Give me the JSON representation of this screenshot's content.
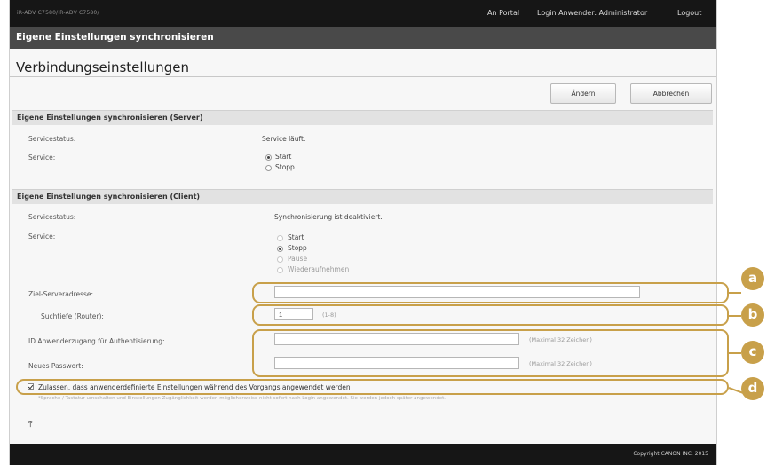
{
  "header": {
    "device_name": "iR-ADV C7580/iR-ADV C7580/",
    "links": [
      "An Portal",
      "Login Anwender: Administrator",
      "Logout"
    ]
  },
  "window_title": "Eigene Einstellungen synchronisieren",
  "page_title": "Verbindungseinstellungen",
  "buttons": {
    "apply": "Ändern",
    "cancel": "Abbrechen"
  },
  "server_section": {
    "title": "Eigene Einstellungen synchronisieren (Server)",
    "status_label": "Servicestatus:",
    "status_value": "Service läuft.",
    "service_label": "Service:",
    "options": [
      "Start",
      "Stopp"
    ],
    "selected": "Start"
  },
  "client_section": {
    "title": "Eigene Einstellungen synchronisieren (Client)",
    "status_label": "Servicestatus:",
    "status_value": "Synchronisierung ist deaktiviert.",
    "service_label": "Service:",
    "options": [
      "Start",
      "Stopp",
      "Pause",
      "Wiederaufnehmen"
    ],
    "selected": "Stopp",
    "server_address_label": "Ziel-Serveradresse:",
    "server_address_value": "",
    "search_depth_label": "Suchtiefe (Router):",
    "search_depth_value": "1",
    "search_depth_hint": "(1-8)",
    "user_id_label": "ID Anwenderzugang für Authentisierung:",
    "user_id_hint": "(Maximal 32 Zeichen)",
    "password_label": "Neues Passwort:",
    "password_hint": "(Maximal 32 Zeichen)",
    "allow_checkbox_label": "Zulassen, dass anwenderdefinierte Einstellungen während des Vorgangs angewendet werden",
    "allow_checked": true,
    "note": "*Sprache / Tastatur umschalten und Einstellungen Zugänglichkeit werden möglicherweise nicht sofort nach Login angewendet. Sie werden jedoch später angewendet."
  },
  "callouts": [
    "a",
    "b",
    "c",
    "d"
  ],
  "scroll_top_glyph": "⤒",
  "footer": "Copyright CANON INC. 2015",
  "colors": {
    "callout": "#c8a04a",
    "topbar": "#161616",
    "titlebar": "#494949"
  }
}
